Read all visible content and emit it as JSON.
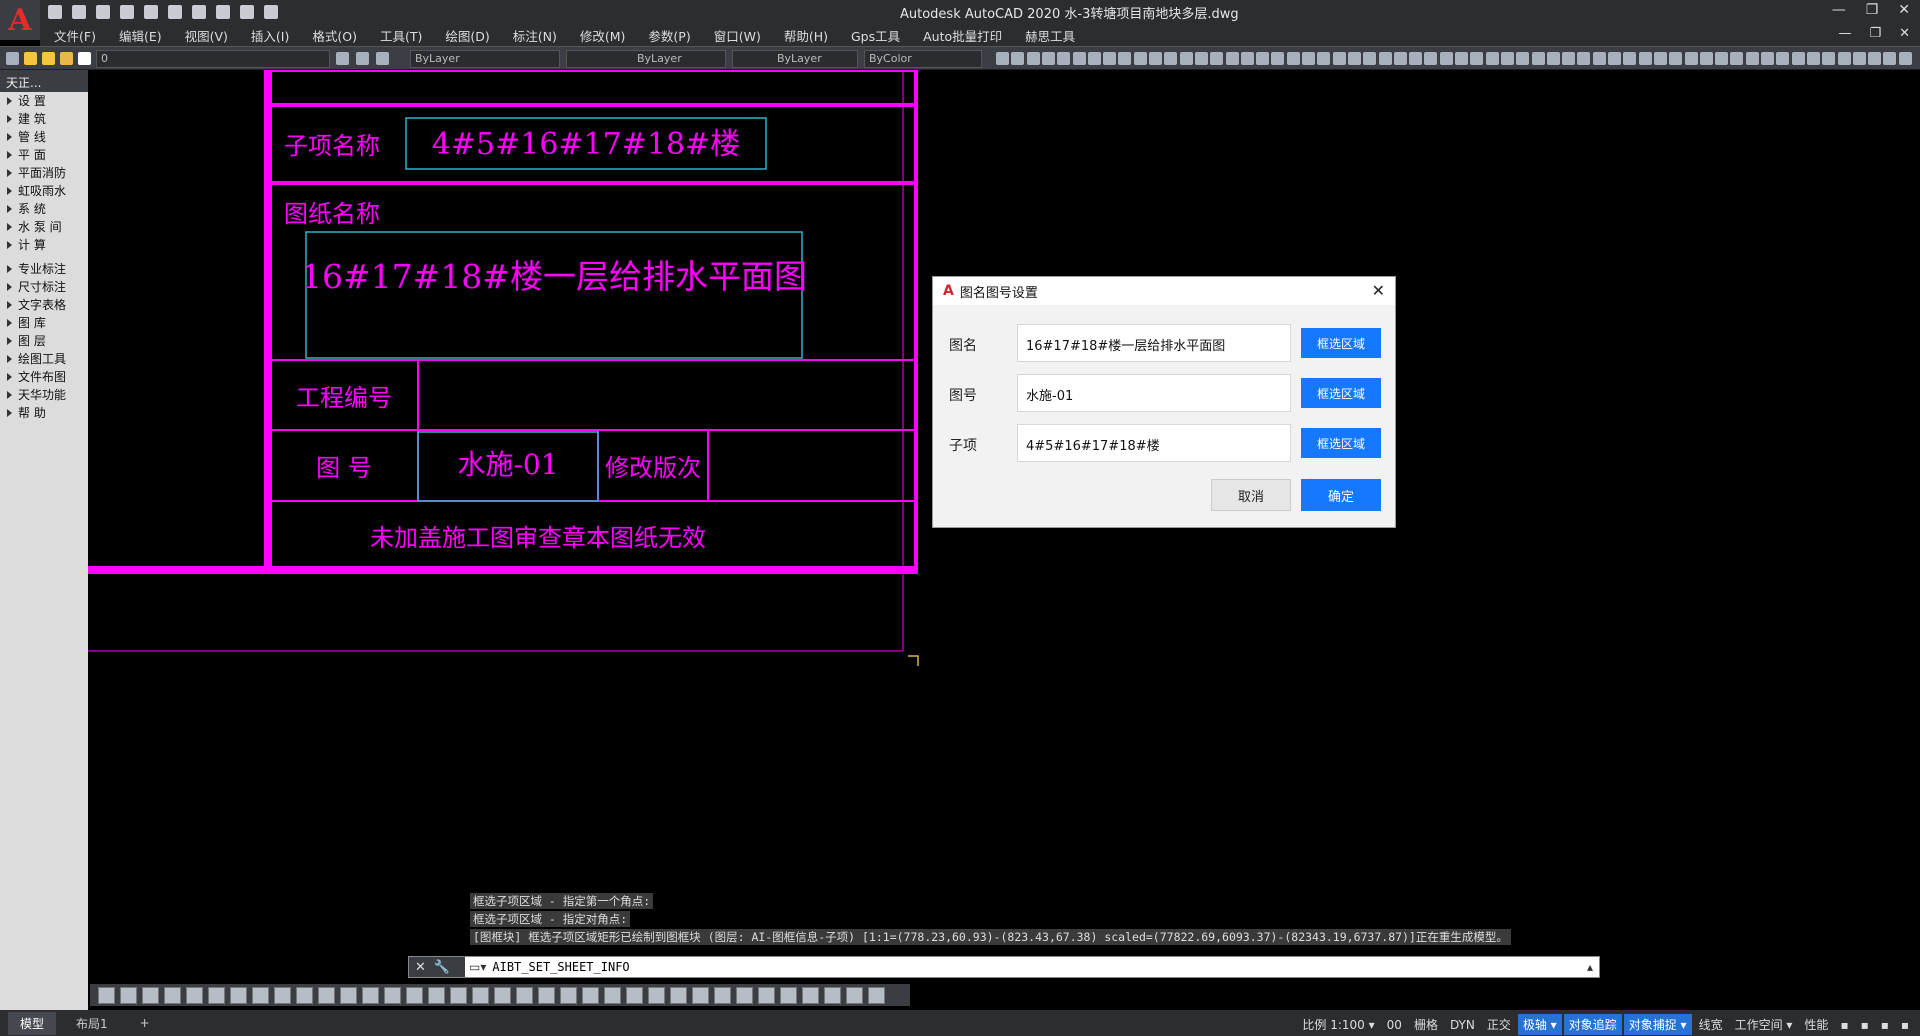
{
  "app": {
    "logo_letter": "A",
    "title": "Autodesk AutoCAD 2020    水-3转塘项目南地块多层.dwg"
  },
  "menu": [
    "文件(F)",
    "编辑(E)",
    "视图(V)",
    "插入(I)",
    "格式(O)",
    "工具(T)",
    "绘图(D)",
    "标注(N)",
    "修改(M)",
    "参数(P)",
    "窗口(W)",
    "帮助(H)",
    "Gps工具",
    "Auto批量打印",
    "赫思工具"
  ],
  "toolbar": {
    "layer": "0",
    "color": "ByLayer",
    "linetype": "ByLayer",
    "lineweight": "ByLayer",
    "plotstyle": "ByColor"
  },
  "left_panel": {
    "header": "天正...",
    "items": [
      "设    置",
      "建    筑",
      "管    线",
      "平    面",
      "平面消防",
      "虹吸雨水",
      "系    统",
      "水 泵 间",
      "计    算"
    ],
    "items2": [
      "专业标注",
      "尺寸标注",
      "文字表格",
      "图    库",
      "图    层",
      "绘图工具",
      "文件布图",
      "天华功能",
      "帮    助"
    ]
  },
  "drawing": {
    "subitem_label": "子项名称",
    "subitem_value": "4#5#16#17#18#楼",
    "sheet_name_label": "图纸名称",
    "sheet_name_value": "16#17#18#楼一层给排水平面图",
    "project_no_label": "工程编号",
    "sheet_no_label": "图  号",
    "sheet_no_value": "水施-01",
    "revision_label": "修改版次",
    "stamp_note": "未加盖施工图审查章本图纸无效",
    "line_color": "#ff00ff",
    "frame_color": "#29b6c9"
  },
  "dialog": {
    "title": "图名图号设置",
    "rows": [
      {
        "label": "图名",
        "value": "16#17#18#楼一层给排水平面图",
        "button": "框选区域"
      },
      {
        "label": "图号",
        "value": "水施-01",
        "button": "框选区域"
      },
      {
        "label": "子项",
        "value": "4#5#16#17#18#楼",
        "button": "框选区域"
      }
    ],
    "cancel": "取消",
    "ok": "确定",
    "accent": "#1677ff"
  },
  "command": {
    "history": [
      "框选子项区域 - 指定第一个角点:",
      "框选子项区域 - 指定对角点:",
      "[图框块] 框选子项区域矩形已绘制到图框块 (图层: AI-图框信息-子项) [1:1=(778.23,60.93)-(823.43,67.38) scaled=(77822.69,6093.37)-(82343.19,6737.87)]正在重生成模型。"
    ],
    "input": "AIBT_SET_SHEET_INFO"
  },
  "status": {
    "tabs": [
      "模型",
      "布局1"
    ],
    "add_tab": "+",
    "scale": "比例 1:100 ▾",
    "items": [
      "00",
      "栅格",
      "DYN",
      "正交",
      "极轴 ▾",
      "对象追踪",
      "对象捕捉 ▾",
      "线宽",
      "工作空间 ▾",
      "性能"
    ],
    "on_items": [
      "极轴 ▾",
      "对象追踪",
      "对象捕捉 ▾"
    ]
  }
}
